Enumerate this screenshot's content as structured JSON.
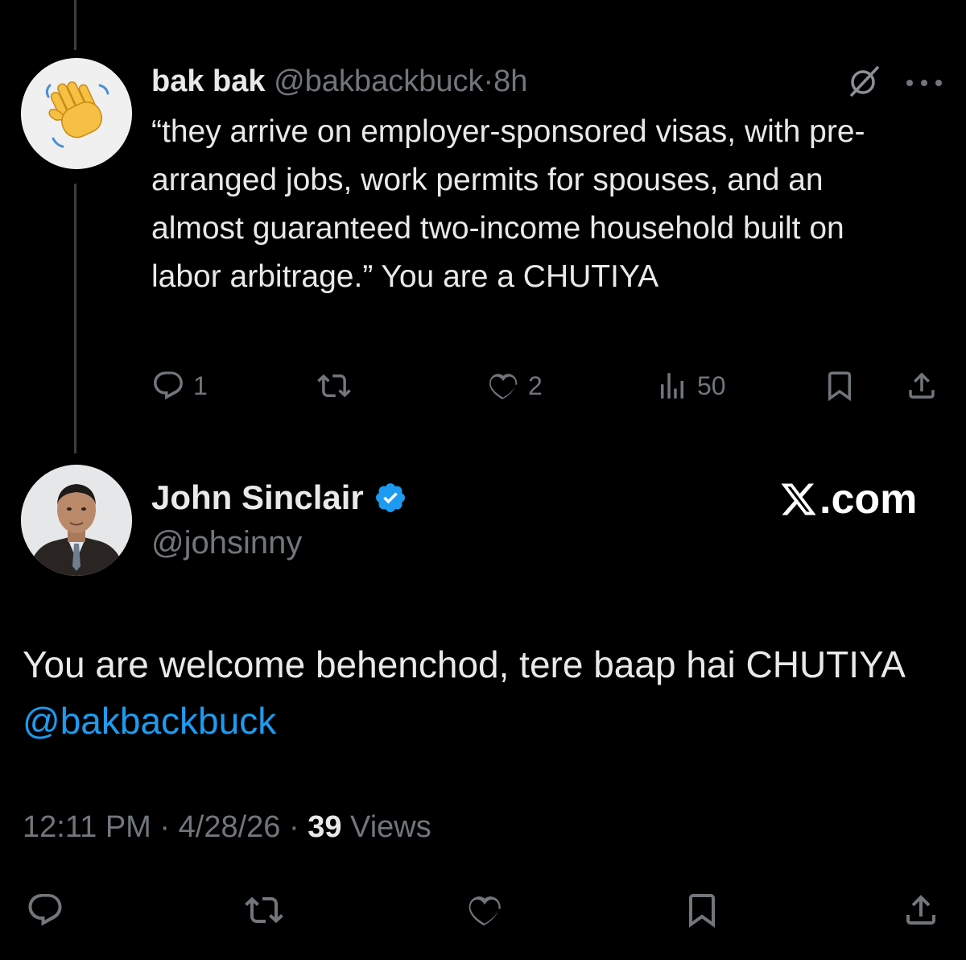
{
  "parent_tweet": {
    "author_name": "bak bak",
    "handle": "@bakbackbuck",
    "separator": "·",
    "time": "8h",
    "text": "“they arrive on employer-sponsored visas, with pre-arranged jobs, work permits for spouses, and an almost guaranteed two-income household built on labor arbitrage.” You are a CHUTIYA",
    "avatar_icon": "waving-hand-emoji",
    "actions": {
      "reply_count": "1",
      "retweet_count": "",
      "like_count": "2",
      "view_count": "50"
    }
  },
  "main_tweet": {
    "author_name": "John Sinclair",
    "verified": true,
    "handle": "@johsinny",
    "brand_suffix": ".com",
    "text": "You are welcome behenchod, tere baap hai CHUTIYA ",
    "mention": "@bakbackbuck",
    "timestamp_time": "12:11 PM",
    "timestamp_date": "4/28/26",
    "dot": "·",
    "views_count": "39",
    "views_label": "Views"
  },
  "colors": {
    "background": "#000000",
    "primary_text": "#e7e9ea",
    "secondary_text": "#71767b",
    "accent_blue": "#1d9bf0",
    "thread_line": "#3a3d41"
  }
}
